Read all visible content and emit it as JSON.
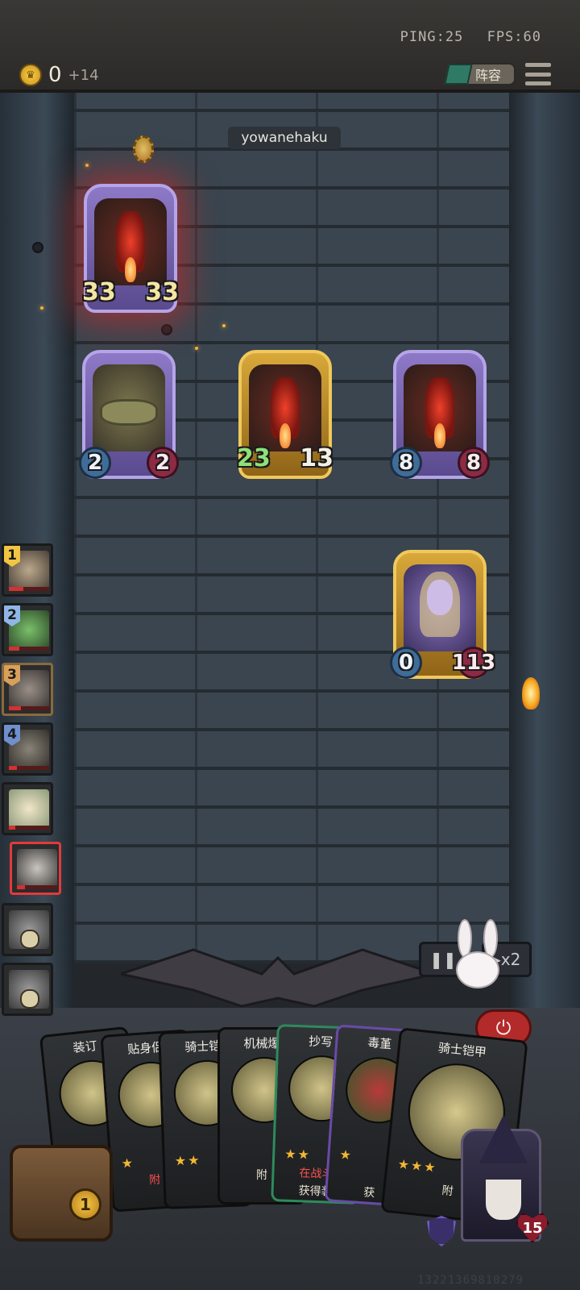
{
  "status": {
    "ping": "PING:25",
    "fps": "FPS:60"
  },
  "gold": {
    "amount": "0",
    "income": "+14"
  },
  "lineup_button": "阵容",
  "opponent_name": "yowanehaku",
  "opponent_board": [
    {
      "atk": "33",
      "hp": "33",
      "frame": "purple"
    },
    {
      "atk": "2",
      "hp": "2",
      "frame": "purple"
    },
    {
      "atk": "23",
      "hp": "13",
      "frame": "gold"
    },
    {
      "atk": "8",
      "hp": "8",
      "frame": "purple"
    },
    {
      "atk": "0",
      "hp": "113",
      "frame": "gold"
    }
  ],
  "players": [
    {
      "rank": "1",
      "color": "#f2c542",
      "hp": 0.35
    },
    {
      "rank": "2",
      "color": "#8fb6e8",
      "hp": 0.25
    },
    {
      "rank": "3",
      "color": "#d9a05a",
      "hp": 0.3
    },
    {
      "rank": "4",
      "color": "#6f8fcf",
      "hp": 0.2
    },
    {
      "rank": "",
      "hp": 0.15
    },
    {
      "rank": "",
      "hp": 0.2,
      "active": true
    }
  ],
  "controls": {
    "speed": "x2"
  },
  "hand": [
    {
      "title": "装订",
      "stars": "",
      "desc": ""
    },
    {
      "title": "贴身侣",
      "stars": "★",
      "desc": "附"
    },
    {
      "title": "骑士铠",
      "stars": "★★",
      "desc": ""
    },
    {
      "title": "机械爆",
      "stars": "",
      "desc": "附"
    },
    {
      "title": "抄写",
      "stars": "★★",
      "desc": "在战斗",
      "desc2": "获得装"
    },
    {
      "title": "毒堇",
      "stars": "★",
      "desc": "获"
    },
    {
      "title": "骑士铠甲",
      "stars": "★★★",
      "desc": "附"
    }
  ],
  "chest_level": "1",
  "hero_hp": "15",
  "footer_id": "13221369810279"
}
